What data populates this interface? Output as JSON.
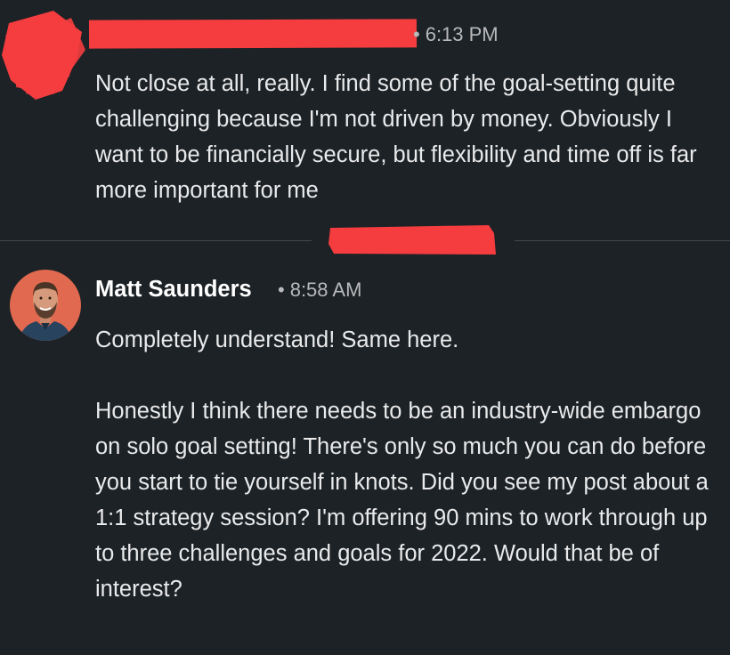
{
  "conversation": {
    "messages": [
      {
        "sender_name": "",
        "timestamp": "6:13 PM",
        "text": "Not close at all, really. I find some of the goal-setting quite challenging because I'm not driven by money. Obviously I want to be financially secure, but flexibility and time off is far more important for me"
      },
      {
        "sender_name": "Matt Saunders",
        "timestamp": "8:58 AM",
        "paragraphs": [
          "Completely understand! Same here.",
          "Honestly I think there needs to be an industry-wide embargo on solo goal setting! There's only so much you can do before you start to tie yourself in knots. Did you see my post about a 1:1 strategy session? I'm offering 90 mins to work through up to three challenges and goals for 2022. Would that be of interest?"
        ]
      }
    ],
    "separator": "•"
  },
  "colors": {
    "background": "#1d2226",
    "text": "#e9eaeb",
    "meta_text": "#b8b9bb",
    "redaction": "#f53d3f",
    "avatar_bg": "#e0694f"
  },
  "icons": {
    "redacted_avatar": "redaction-scribble",
    "sender_avatar": "profile-photo"
  }
}
